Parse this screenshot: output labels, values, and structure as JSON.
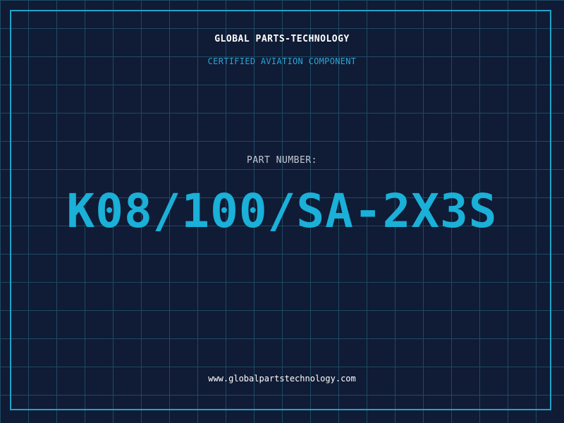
{
  "header": {
    "company": "GLOBAL PARTS-TECHNOLOGY",
    "tagline": "CERTIFIED AVIATION COMPONENT"
  },
  "part": {
    "label": "PART NUMBER:",
    "number": "K08/100/SA-2X3S"
  },
  "footer": {
    "website": "www.globalpartstechnology.com"
  },
  "colors": {
    "background": "#101b35",
    "grid": "#1e4a63",
    "frame": "#1fa3c9",
    "accent": "#1ab0d8",
    "title": "#ffffff",
    "label": "#c4c9d4"
  }
}
